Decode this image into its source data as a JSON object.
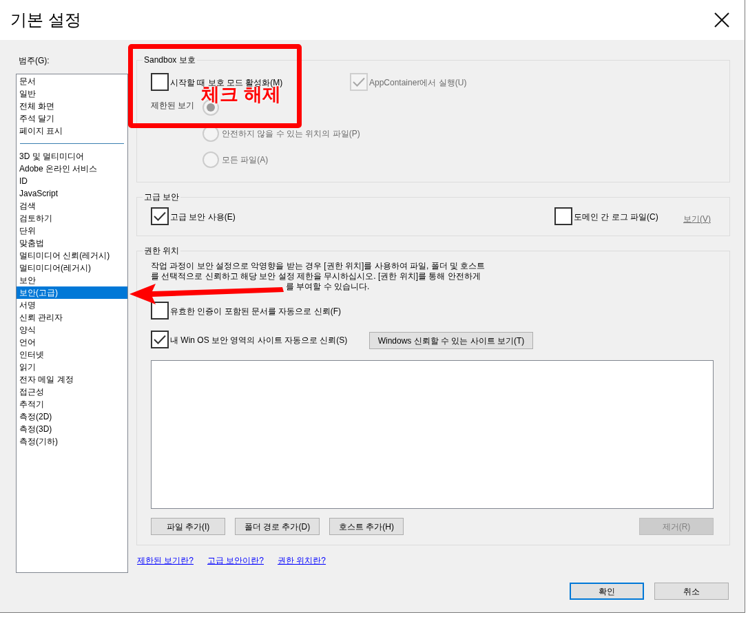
{
  "window": {
    "title": "기본 설정"
  },
  "category_label": "범주(G):",
  "category_groups": [
    {
      "items": [
        {
          "label": "문서",
          "selected": false
        },
        {
          "label": "일반",
          "selected": false
        },
        {
          "label": "전체 화면",
          "selected": false
        },
        {
          "label": "주석 달기",
          "selected": false
        },
        {
          "label": "페이지 표시",
          "selected": false
        }
      ]
    },
    {
      "items": [
        {
          "label": "3D 및 멀티미디어",
          "selected": false
        },
        {
          "label": "Adobe 온라인 서비스",
          "selected": false
        },
        {
          "label": "ID",
          "selected": false
        },
        {
          "label": "JavaScript",
          "selected": false
        },
        {
          "label": "검색",
          "selected": false
        },
        {
          "label": "검토하기",
          "selected": false
        },
        {
          "label": "단위",
          "selected": false
        },
        {
          "label": "맞춤법",
          "selected": false
        },
        {
          "label": "멀티미디어 신뢰(레거시)",
          "selected": false
        },
        {
          "label": "멀티미디어(레거시)",
          "selected": false
        },
        {
          "label": "보안",
          "selected": false
        },
        {
          "label": "보안(고급)",
          "selected": true
        },
        {
          "label": "서명",
          "selected": false
        },
        {
          "label": "신뢰 관리자",
          "selected": false
        },
        {
          "label": "양식",
          "selected": false
        },
        {
          "label": "언어",
          "selected": false
        },
        {
          "label": "인터넷",
          "selected": false
        },
        {
          "label": "읽기",
          "selected": false
        },
        {
          "label": "전자 메일 계정",
          "selected": false
        },
        {
          "label": "접근성",
          "selected": false
        },
        {
          "label": "추적기",
          "selected": false
        },
        {
          "label": "측정(2D)",
          "selected": false
        },
        {
          "label": "측정(3D)",
          "selected": false
        },
        {
          "label": "측정(기하)",
          "selected": false
        }
      ]
    }
  ],
  "sandbox": {
    "title": "Sandbox 보호",
    "protected_mode": {
      "label": "시작할 때 보호 모드 활성화(M)",
      "checked": false,
      "disabled": false
    },
    "app_container": {
      "label": "AppContainer에서 실행(U)",
      "checked": true,
      "disabled": true
    },
    "protected_view": {
      "label": "제한된 보기",
      "disabled": true,
      "options": [
        {
          "selected": true
        },
        {
          "label": "안전하지 않을 수 있는 위치의 파일(P)",
          "selected": false
        },
        {
          "label": "모든 파일(A)",
          "selected": false
        }
      ]
    }
  },
  "enhanced_security": {
    "title": "고급 보안",
    "enable": {
      "label": "고급 보안 사용(E)",
      "checked": true,
      "disabled": false
    },
    "cross_domain_log": {
      "label": "도메인 간 로그 파일(C)",
      "checked": false,
      "disabled": false
    },
    "view_link": {
      "label": "보기(V)",
      "disabled": true
    }
  },
  "privileged_locations": {
    "title": "권한 위치",
    "description": "작업 과정이 보안 설정으로 악영향을 받는 경우 [권한 위치]를 사용하여 파일, 폴더 및 호스트를 선택적으로 신뢰하고 해당 보안 설정 제한을 무시하십시오. [권한 위치]를 통해 안전하게",
    "description_tail": "를 부여할 수 있습니다.",
    "trust_certified": {
      "label": "유효한 인증이 포함된 문서를 자동으로 신뢰(F)",
      "checked": false,
      "disabled": false
    },
    "trust_win_os": {
      "label": "내 Win OS 보안 영역의 사이트 자동으로 신뢰(S)",
      "checked": true,
      "disabled": false
    },
    "windows_sites_button": "Windows 신뢰할 수 있는 사이트 보기(T)",
    "buttons": [
      {
        "label": "파일 추가(I)",
        "disabled": false
      },
      {
        "label": "폴더 경로 추가(D)",
        "disabled": false
      },
      {
        "label": "호스트 추가(H)",
        "disabled": false
      },
      {
        "label": "제거(R)",
        "disabled": true
      }
    ]
  },
  "help_links": [
    "제한된 보기란?",
    "고급 보안이란?",
    "권한 위치란?"
  ],
  "footer_buttons": [
    {
      "label": "확인",
      "focused": true
    },
    {
      "label": "취소",
      "focused": false
    }
  ],
  "annotation": {
    "text": "체크 해제"
  }
}
